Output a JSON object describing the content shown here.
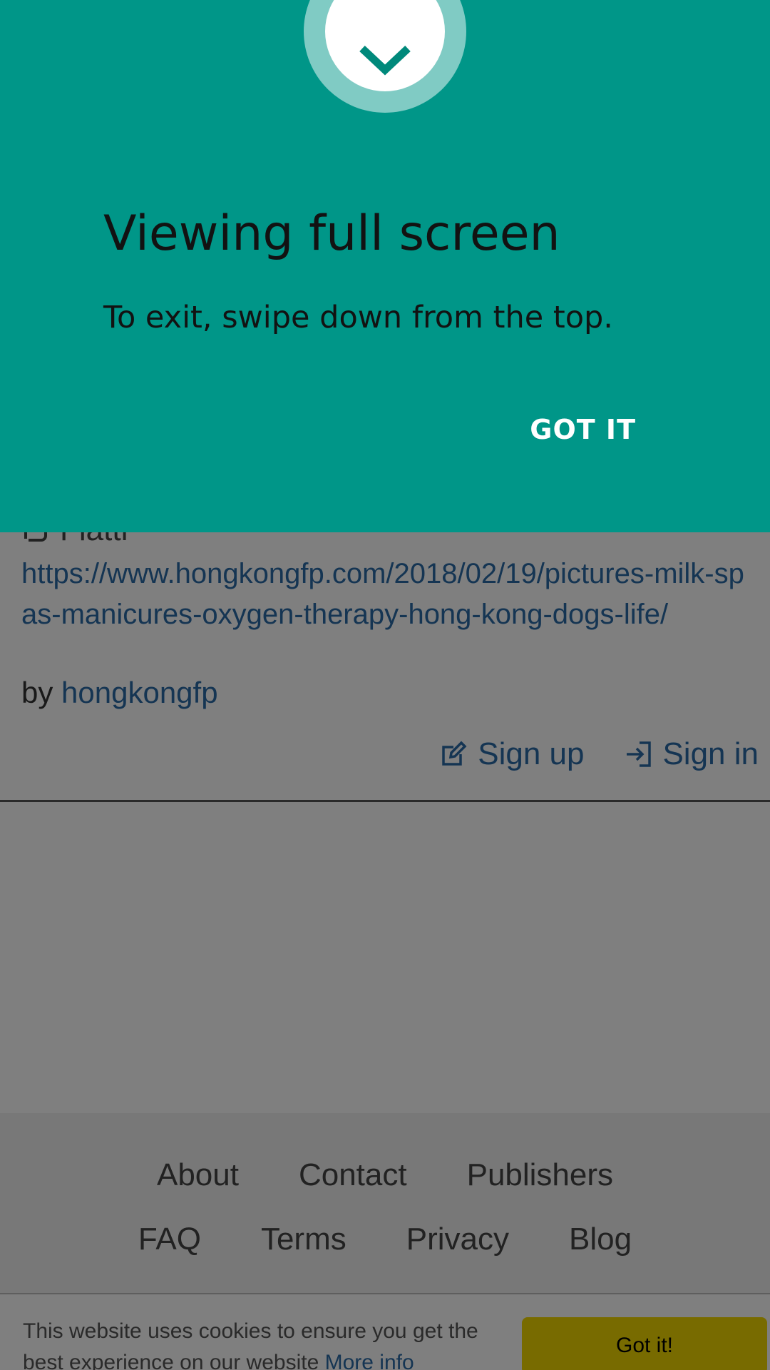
{
  "page": {
    "flattr_label": "Flattr",
    "url": "https://www.hongkongfp.com/2018/02/19/pictures-milk-spas-manicures-oxygen-therapy-hong-kong-dogs-life/",
    "by_prefix": "by",
    "author": "hongkongfp",
    "signup_label": "Sign up",
    "signin_label": "Sign in"
  },
  "footer": {
    "row1": [
      "About",
      "Contact",
      "Publishers"
    ],
    "row2": [
      "FAQ",
      "Terms",
      "Privacy",
      "Blog"
    ]
  },
  "cookie": {
    "text": "This website uses cookies to ensure you get the best experience on our website",
    "more_info": "More info",
    "button": "Got it!"
  },
  "banner": {
    "title": "Viewing full screen",
    "message": "To exit, swipe down from the top.",
    "button": "GOT IT"
  },
  "colors": {
    "banner_bg": "#009688",
    "badge_ring": "#80cbc4",
    "link": "#2a6aa6",
    "cookie_button": "#f1d600"
  },
  "icons": {
    "badge": "chevron-down-icon",
    "flattr": "flattr-icon",
    "signup": "edit-icon",
    "signin": "sign-in-icon"
  }
}
